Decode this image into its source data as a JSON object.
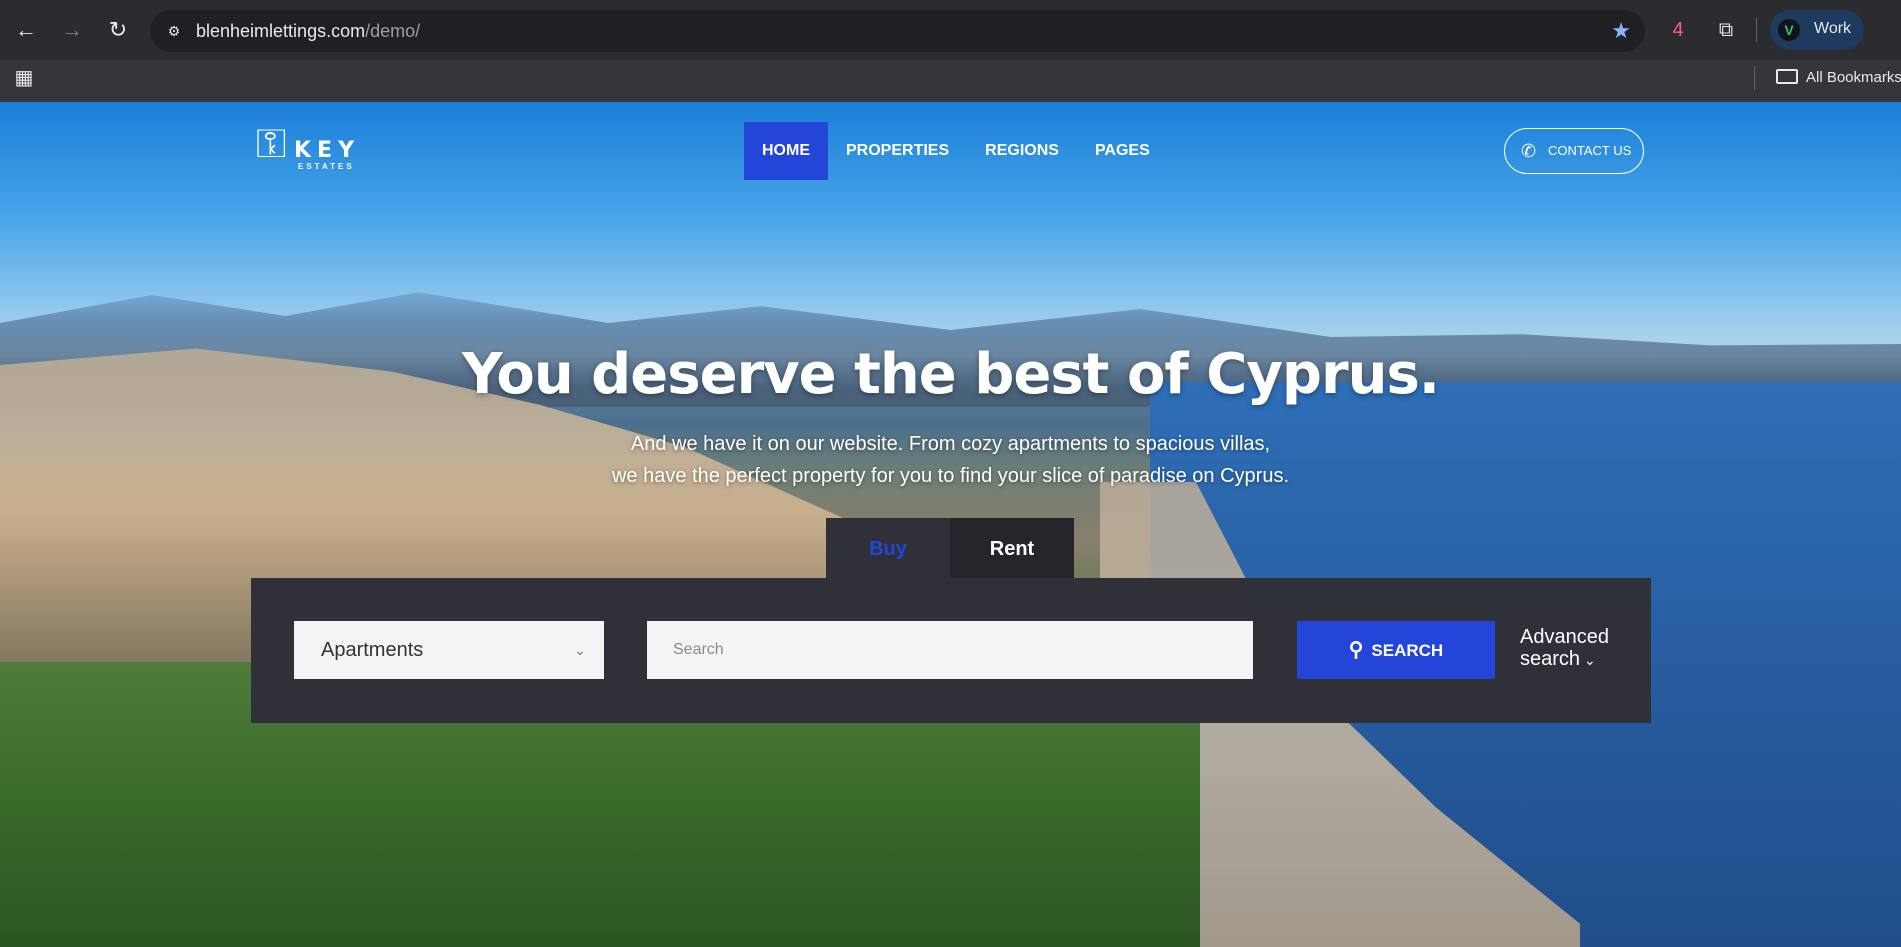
{
  "browser": {
    "url_domain": "blenheimlettings.com",
    "url_path": "/demo/",
    "profile_label": "Work",
    "profile_initial": "V",
    "bookmarks_label": "All Bookmarks",
    "icons": {
      "back": "←",
      "forward": "→",
      "reload": "↻",
      "site_info": "⚙",
      "star": "★",
      "extension_badge": "4",
      "extensions": "⧉",
      "apps": "▦"
    }
  },
  "site": {
    "logo_word": "KEY",
    "logo_sub": "ESTATES",
    "nav": [
      "HOME",
      "PROPERTIES",
      "REGIONS",
      "PAGES"
    ],
    "contact_label": "CONTACT US",
    "hero_title": "You deserve the best of Cyprus.",
    "hero_sub_line1": "And we have it on our website. From cozy apartments to spacious villas,",
    "hero_sub_line2": "we have the perfect property for you to find your slice of paradise on Cyprus.",
    "tabs": {
      "buy": "Buy",
      "rent": "Rent"
    },
    "search": {
      "property_type": "Apartments",
      "placeholder": "Search",
      "button_label": "SEARCH",
      "advanced_line1": "Advanced",
      "advanced_line2": "search"
    },
    "colors": {
      "accent": "#2346d8",
      "panel": "#2f3038"
    }
  }
}
